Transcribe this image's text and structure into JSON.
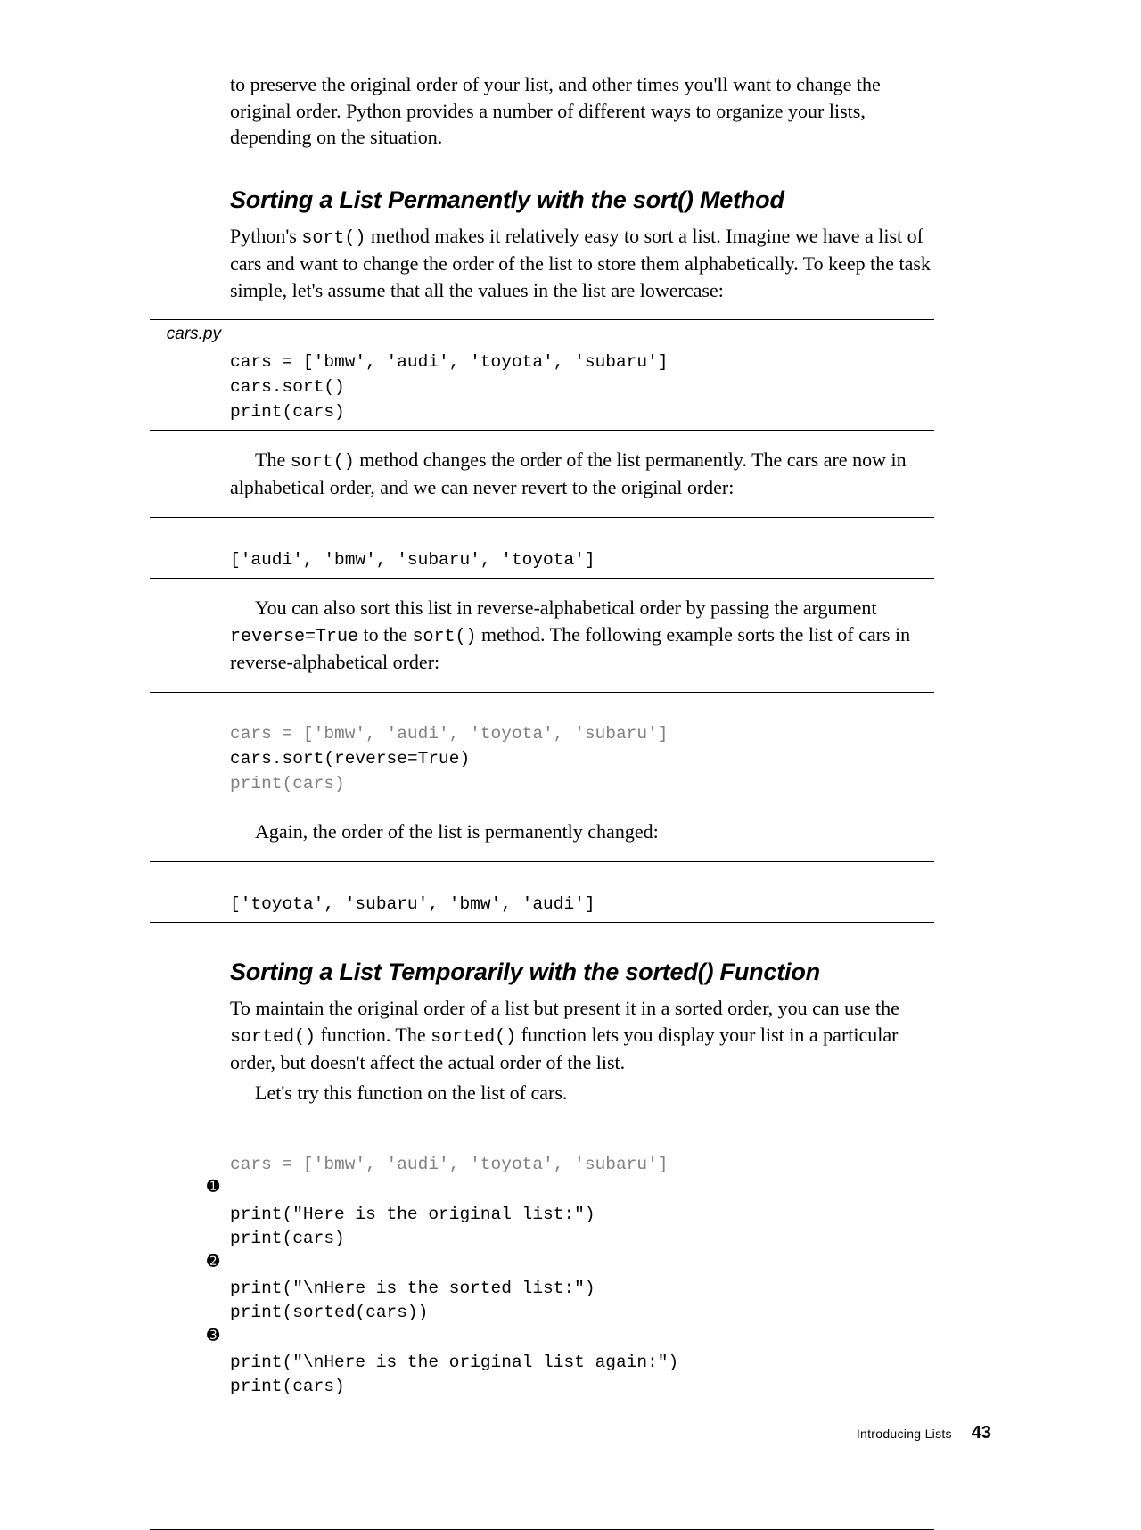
{
  "intro_p1": "to preserve the original order of your list, and other times you'll want to change the original order. Python provides a number of different ways to organize your lists, depending on the situation.",
  "section1": {
    "heading": "Sorting a List Permanently with the sort() Method",
    "p1a": "Python's ",
    "p1_code1": "sort()",
    "p1b": " method makes it relatively easy to sort a list. Imagine we have a list of cars and want to change the order of the list to store them alphabetically. To keep the task simple, let's assume that all the values in the list are lowercase:",
    "code1_label": "cars.py",
    "code1_l1": "cars = ['bmw', 'audi', 'toyota', 'subaru']",
    "code1_l2": "cars.sort()",
    "code1_l3": "print(cars)",
    "p2a": "The ",
    "p2_code1": "sort()",
    "p2b": " method changes the order of the list permanently. The cars are now in alphabetical order, and we can never revert to the original order:",
    "out1_l1": "['audi', 'bmw', 'subaru', 'toyota']",
    "p3a": "You can also sort this list in reverse-alphabetical order by passing the argument ",
    "p3_code1": "reverse=True",
    "p3b": " to the ",
    "p3_code2": "sort()",
    "p3c": " method. The following example sorts the list of cars in reverse-alphabetical order:",
    "code2_l1": "cars = ['bmw', 'audi', 'toyota', 'subaru']",
    "code2_l2": "cars.sort(reverse=True)",
    "code2_l3": "print(cars)",
    "p4": "Again, the order of the list is permanently changed:",
    "out2_l1": "['toyota', 'subaru', 'bmw', 'audi']"
  },
  "section2": {
    "heading": "Sorting a List Temporarily with the sorted() Function",
    "p1a": "To maintain the original order of a list but present it in a sorted order, you can use the ",
    "p1_code1": "sorted()",
    "p1b": " function. The ",
    "p1_code2": "sorted()",
    "p1c": " function lets you display your list in a particular order, but doesn't affect the actual order of the list.",
    "p2": "Let's try this function on the list of cars.",
    "code1_l1": "cars = ['bmw', 'audi', 'toyota', 'subaru']",
    "code1_blank1": " ",
    "code1_l2": "print(\"Here is the original list:\")",
    "code1_l3": "print(cars)",
    "code1_blank2": " ",
    "code1_l4": "print(\"\\nHere is the sorted list:\")",
    "code1_l5": "print(sorted(cars))",
    "code1_blank3": " ",
    "code1_l6": "print(\"\\nHere is the original list again:\")",
    "code1_l7": "print(cars)",
    "callout1": "➊",
    "callout2": "➋",
    "callout3": "➌"
  },
  "footer": {
    "chapter": "Introducing Lists",
    "page": "43"
  }
}
